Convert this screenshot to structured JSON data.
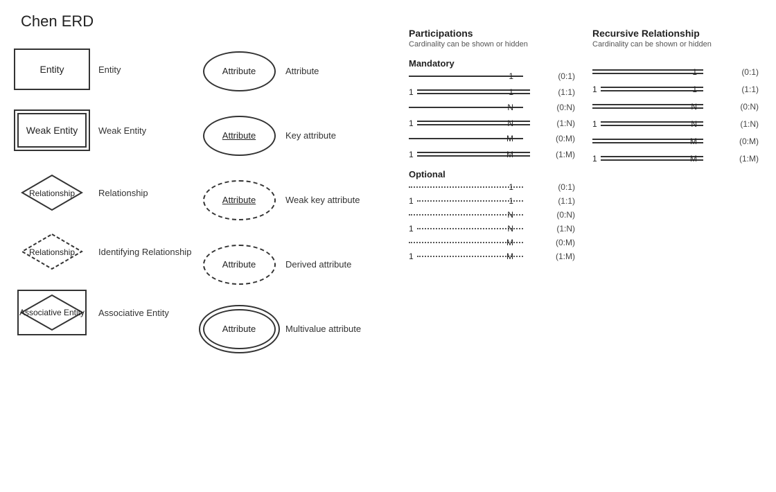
{
  "title": "Chen ERD",
  "shapes": {
    "entity": {
      "label": "Entity",
      "name": "Entity"
    },
    "weakEntity": {
      "label": "Weak Entity",
      "name": "Weak Entity"
    },
    "relationship": {
      "label": "Relationship",
      "name": "Relationship"
    },
    "identifyingRelationship": {
      "label": "Relationship",
      "name": "Identifying Relationship"
    },
    "associativeEntity": {
      "label": "Associative Entity",
      "name": "Associative Entity"
    }
  },
  "attributes": {
    "regular": {
      "label": "Attribute",
      "name": "Attribute"
    },
    "key": {
      "label": "Attribute",
      "name": "Key attribute"
    },
    "weakKey": {
      "label": "Attribute",
      "name": "Weak key attribute"
    },
    "derived": {
      "label": "Attribute",
      "name": "Derived attribute"
    },
    "multivalue": {
      "label": "Attribute",
      "name": "Multivalue attribute"
    }
  },
  "participations": {
    "title": "Participations",
    "subtitle": "Cardinality can be shown or hidden",
    "mandatory": {
      "title": "Mandatory",
      "rows": [
        {
          "left": "",
          "right": "1",
          "cardinality": "(0:1)"
        },
        {
          "left": "1",
          "right": "1",
          "cardinality": "(1:1)"
        },
        {
          "left": "",
          "right": "N",
          "cardinality": "(0:N)"
        },
        {
          "left": "1",
          "right": "N",
          "cardinality": "(1:N)"
        },
        {
          "left": "",
          "right": "M",
          "cardinality": "(0:M)"
        },
        {
          "left": "1",
          "right": "M",
          "cardinality": "(1:M)"
        }
      ]
    },
    "optional": {
      "title": "Optional",
      "rows": [
        {
          "left": "",
          "right": "1",
          "cardinality": "(0:1)"
        },
        {
          "left": "1",
          "right": "1",
          "cardinality": "(1:1)"
        },
        {
          "left": "",
          "right": "N",
          "cardinality": "(0:N)"
        },
        {
          "left": "1",
          "right": "N",
          "cardinality": "(1:N)"
        },
        {
          "left": "",
          "right": "M",
          "cardinality": "(0:M)"
        },
        {
          "left": "1",
          "right": "M",
          "cardinality": "(1:M)"
        }
      ]
    }
  },
  "recursive": {
    "title": "Recursive Relationship",
    "subtitle": "Cardinality can be shown or hidden",
    "rows": [
      {
        "left": "",
        "right": "1",
        "cardinality": "(0:1)"
      },
      {
        "left": "1",
        "right": "1",
        "cardinality": "(1:1)"
      },
      {
        "left": "",
        "right": "N",
        "cardinality": "(0:N)"
      },
      {
        "left": "1",
        "right": "N",
        "cardinality": "(1:N)"
      },
      {
        "left": "",
        "right": "M",
        "cardinality": "(0:M)"
      },
      {
        "left": "1",
        "right": "M",
        "cardinality": "(1:M)"
      }
    ]
  }
}
